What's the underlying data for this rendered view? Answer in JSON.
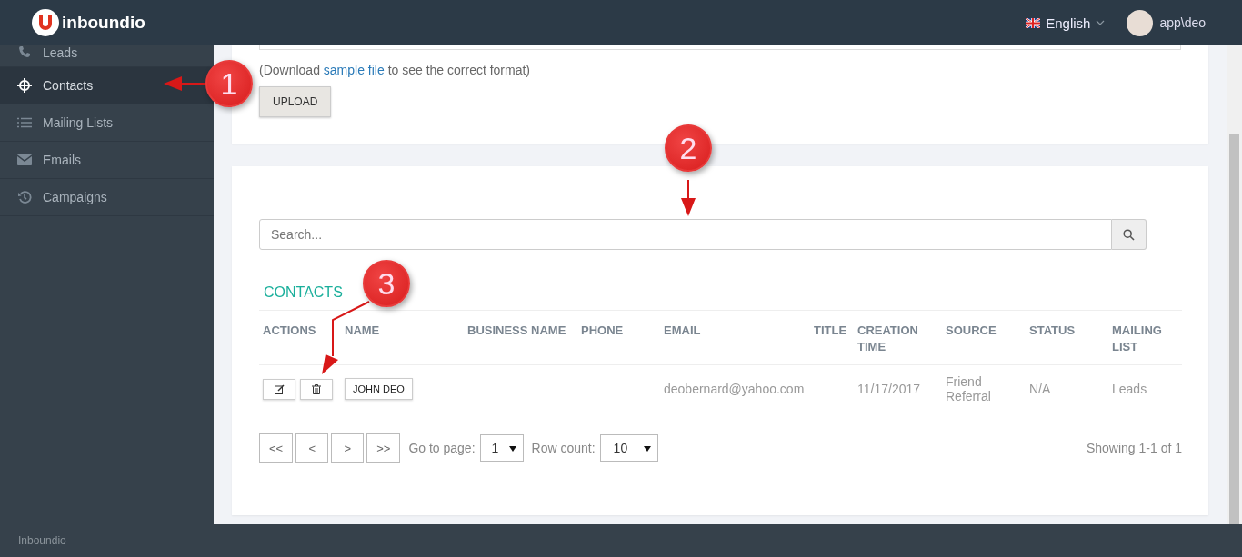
{
  "header": {
    "logo": "inboundio",
    "language": "English",
    "user": "app\\deo"
  },
  "sidebar": {
    "items": [
      {
        "label": "Leads",
        "selected": false
      },
      {
        "label": "Contacts",
        "selected": true
      },
      {
        "label": "Mailing Lists",
        "selected": false
      },
      {
        "label": "Emails",
        "selected": false
      },
      {
        "label": "Campaigns",
        "selected": false
      }
    ],
    "footer": "Inboundio"
  },
  "upload": {
    "note": "(Download ",
    "link": "sample file",
    "note_end": " to see the correct format)",
    "button": "UPLOAD"
  },
  "search": {
    "placeholder": "Search..."
  },
  "contacts": {
    "title": "CONTACTS",
    "columns": [
      {
        "label": "ACTIONS",
        "kind": "actions"
      },
      {
        "label": "NAME",
        "kind": "tag"
      },
      {
        "label": "BUSINESS NAME",
        "kind": "text"
      },
      {
        "label": "PHONE",
        "kind": "text"
      },
      {
        "label": "EMAIL",
        "kind": "text"
      },
      {
        "label": "TITLE",
        "kind": "text"
      },
      {
        "label": "CREATION TIME",
        "kind": "text"
      },
      {
        "label": "SOURCE",
        "kind": "text"
      },
      {
        "label": "STATUS",
        "kind": "text"
      },
      {
        "label": "MAILING LIST",
        "kind": "text"
      }
    ],
    "rows": [
      {
        "cells": [
          null,
          "JOHN DEO",
          null,
          null,
          "deobernard@yahoo.com",
          null,
          "11/17/2017",
          "Friend Referral",
          "N/A",
          "Leads"
        ]
      }
    ]
  },
  "pagination": {
    "buttons": [
      "<<",
      "<",
      ">",
      ">>"
    ],
    "page_label": "Go to page:",
    "page": "1",
    "count_label": "Row count:",
    "count": "10",
    "summary": "Showing 1-1 of 1"
  },
  "callouts": [
    {
      "label": "1"
    },
    {
      "label": "2"
    },
    {
      "label": "3"
    }
  ]
}
